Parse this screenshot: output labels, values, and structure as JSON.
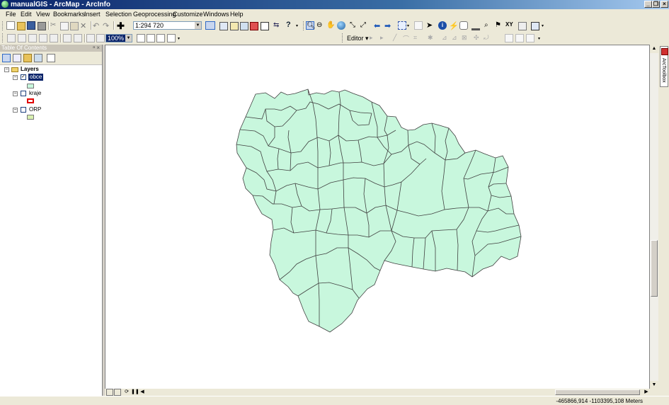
{
  "window": {
    "title": "manualGIS - ArcMap - ArcInfo"
  },
  "menu": [
    "File",
    "Edit",
    "View",
    "Bookmarks",
    "Insert",
    "Selection",
    "Geoprocessing",
    "Customize",
    "Windows",
    "Help"
  ],
  "toolbar": {
    "scale": "1:294 720",
    "zoom": "100%",
    "editor_label": "Editor ▾"
  },
  "toc": {
    "title": "Table Of Contents",
    "group_label": "Layers",
    "layers": [
      {
        "name": "obce",
        "checked": true,
        "selected": true,
        "symbol_fill": "#c8f7dd",
        "symbol_border": "#7a7a7a"
      },
      {
        "name": "kraje",
        "checked": false,
        "selected": false,
        "symbol_fill": "#ffffff",
        "symbol_border": "#e00000"
      },
      {
        "name": "ORP",
        "checked": false,
        "selected": false,
        "symbol_fill": "#d8f0b0",
        "symbol_border": "#7a7a7a"
      }
    ]
  },
  "map": {
    "fill_color": "#c8f7dd",
    "stroke_color": "#404040"
  },
  "side_panel": {
    "tab_label": "ArcToolbox"
  },
  "status": {
    "coordinates": "-465866,914 -1103395,108 Meters"
  }
}
